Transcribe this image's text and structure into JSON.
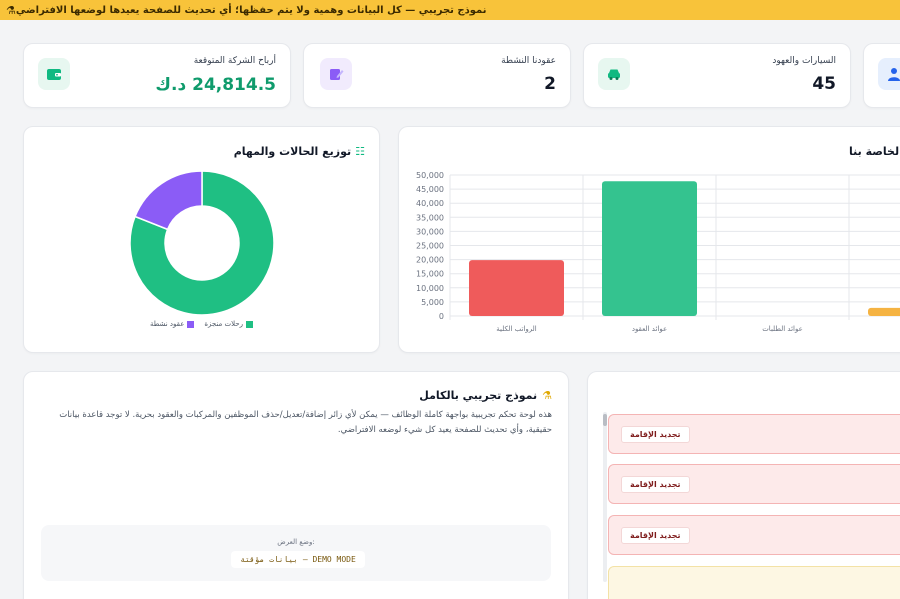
{
  "banner": {
    "text": "نموذج تجريبي — كل البيانات وهمية ولا يتم حفظها؛ أي تحديث للصفحة يعيدها لوضعها الافتراضي"
  },
  "stats": [
    {
      "label": "أرباح الشركة المتوقعة",
      "value": "24,814.5 د.ك",
      "icon": "wallet-icon",
      "color": "#10b981"
    },
    {
      "label": "عقودنا النشطة",
      "value": "2",
      "icon": "contract-edit-icon",
      "color": "#8b5cf6"
    },
    {
      "label": "السيارات والعهود",
      "value": "45",
      "icon": "car-icon",
      "color": "#10b981"
    },
    {
      "label": "",
      "value": "",
      "icon": "user-icon",
      "color": "#2563eb"
    }
  ],
  "donut_panel": {
    "title": "توزيع الحالات والمهام",
    "legend": [
      {
        "label": "رحلات منجزة",
        "color": "#1fbf83"
      },
      {
        "label": "عقود نشطة",
        "color": "#8b5cf6"
      }
    ]
  },
  "bar_panel": {
    "title": "الخاصة بنا"
  },
  "chart_data": [
    {
      "type": "pie",
      "categories": [
        "رحلات منجزة",
        "عقود نشطة"
      ],
      "values": [
        81,
        19
      ],
      "colors": [
        "#1fbf83",
        "#8b5cf6"
      ],
      "donut": true,
      "title": "توزيع الحالات والمهام"
    },
    {
      "type": "bar",
      "categories": [
        "الرواتب الكلية",
        "عوائد العقود",
        "عوائد الطلبات",
        "..."
      ],
      "values": [
        19800,
        47800,
        0,
        2900
      ],
      "colors": [
        "#ef5b5b",
        "#34c38f",
        "#cccccc",
        "#f5b342"
      ],
      "yticks": [
        "0",
        "5,000",
        "10,000",
        "15,000",
        "20,000",
        "25,000",
        "30,000",
        "35,000",
        "40,000",
        "45,000",
        "50,000"
      ],
      "ylim": [
        0,
        50000
      ],
      "grid": true,
      "title": "الخاصة بنا"
    }
  ],
  "demo_panel": {
    "title": "نموذج تجريبي بالكامل",
    "text": "هذه لوحة تحكم تجريبية بواجهة كاملة الوظائف — يمكن لأي زائر إضافة/تعديل/حذف الموظفين والمركبات والعقود بحرية. لا توجد قاعدة بيانات حقيقية، وأي تحديث للصفحة يعيد كل شيء لوضعه الافتراضي.",
    "mode_label": "وضع العرض:",
    "mode_value": "DEMO MODE — بيانات مؤقتة"
  },
  "tasks": [
    {
      "label": "تجديد الإقامة"
    },
    {
      "label": "تجديد الإقامة"
    },
    {
      "label": "تجديد الإقامة"
    }
  ]
}
